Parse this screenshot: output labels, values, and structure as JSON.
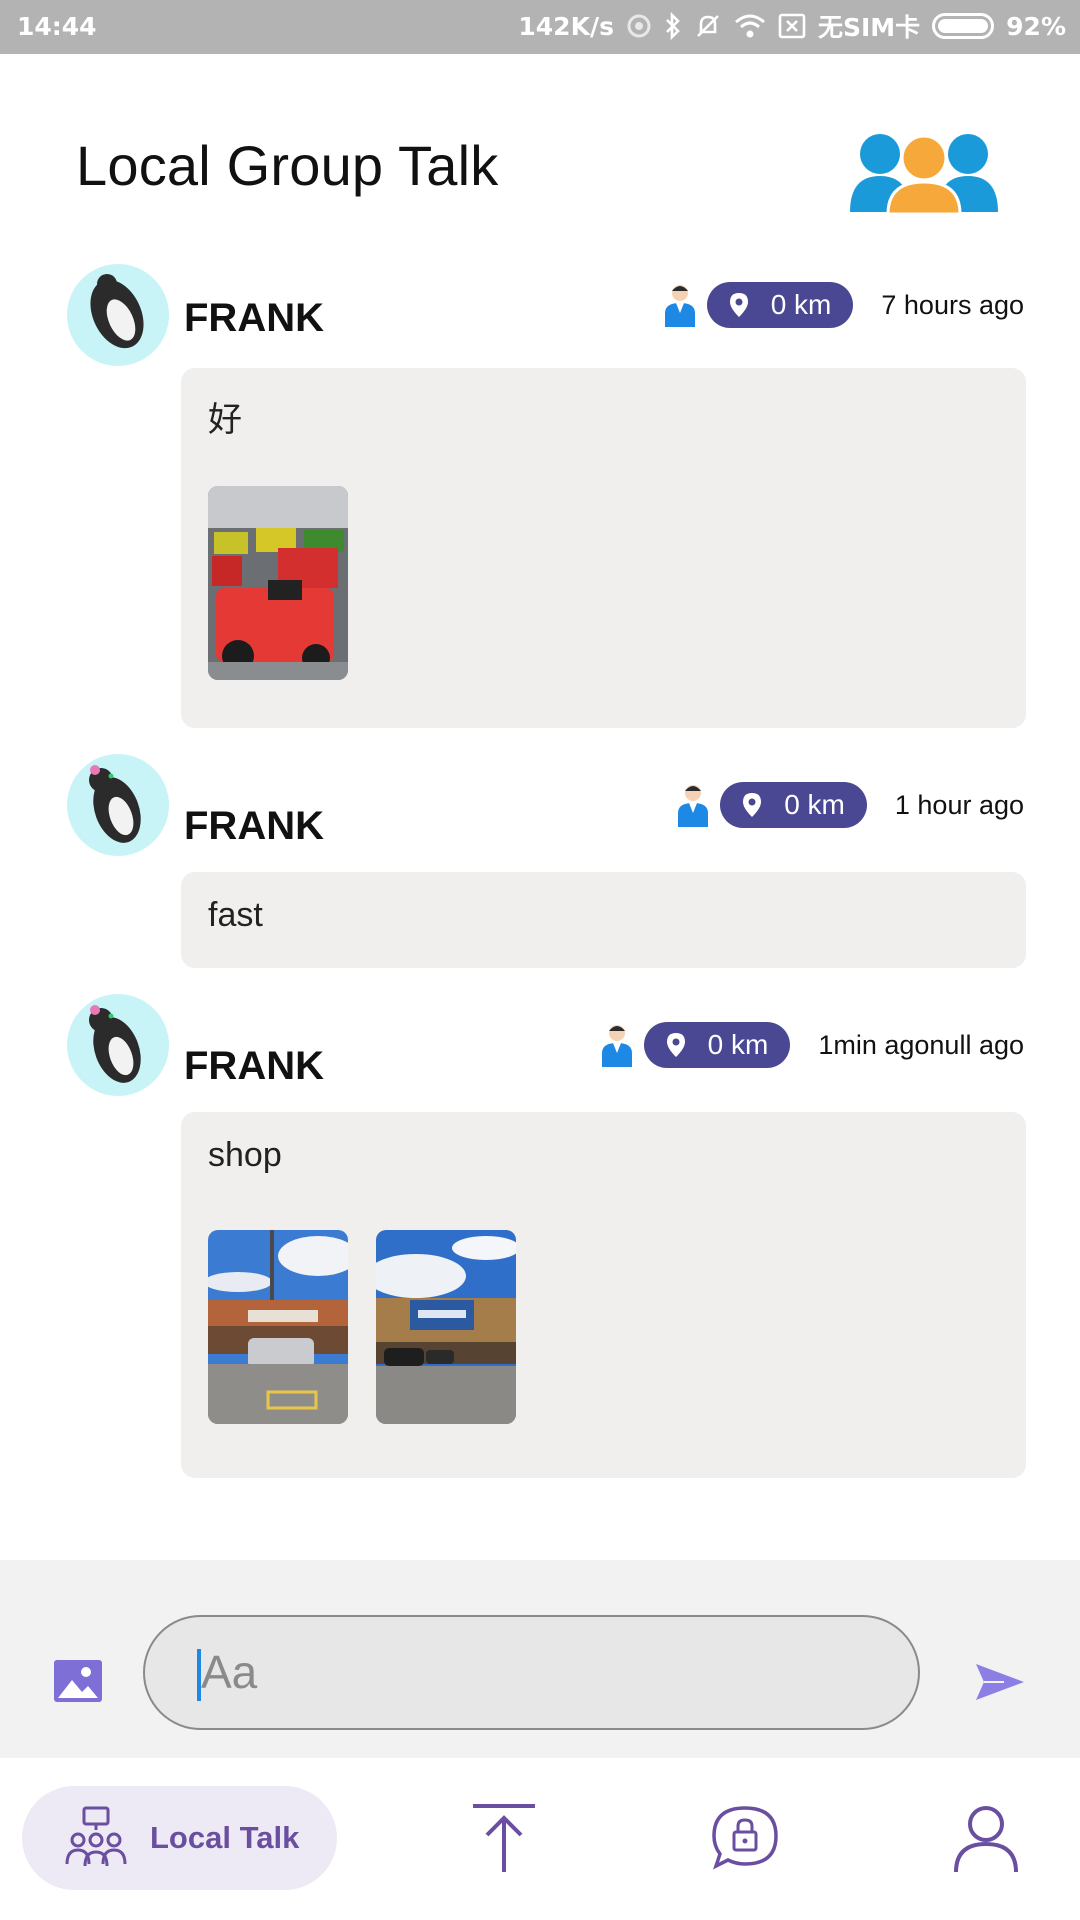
{
  "status_bar": {
    "time": "14:44",
    "speed": "142K/s",
    "carrier": "无SIM卡",
    "battery": "92%"
  },
  "header": {
    "title": "Local Group Talk",
    "logo_icon": "group-people-icon"
  },
  "messages": [
    {
      "sender": "FRANK",
      "distance": "0 km",
      "time_ago": "7 hours ago",
      "text": "好",
      "photos": [
        "lawn-tractors-photo"
      ]
    },
    {
      "sender": "FRANK",
      "distance": "0 km",
      "time_ago": "1 hour ago",
      "text": "fast",
      "photos": []
    },
    {
      "sender": "FRANK",
      "distance": "0 km",
      "time_ago": "1min agonull ago",
      "text": "shop",
      "photos": [
        "store-parking-photo",
        "walmart-storefront-photo"
      ]
    }
  ],
  "composer": {
    "placeholder": "Aa",
    "image_icon": "image-icon",
    "send_icon": "send-icon"
  },
  "nav": {
    "items": [
      {
        "label": "Local Talk",
        "icon": "group-icon",
        "active": true
      },
      {
        "label": "",
        "icon": "upload-icon",
        "active": false
      },
      {
        "label": "",
        "icon": "private-chat-lock-icon",
        "active": false
      },
      {
        "label": "",
        "icon": "profile-icon",
        "active": false
      }
    ]
  },
  "colors": {
    "accent": "#4a4893",
    "nav_accent": "#6a4fa0",
    "bubble": "#f0efee",
    "status_bar": "#b3b3b3"
  }
}
